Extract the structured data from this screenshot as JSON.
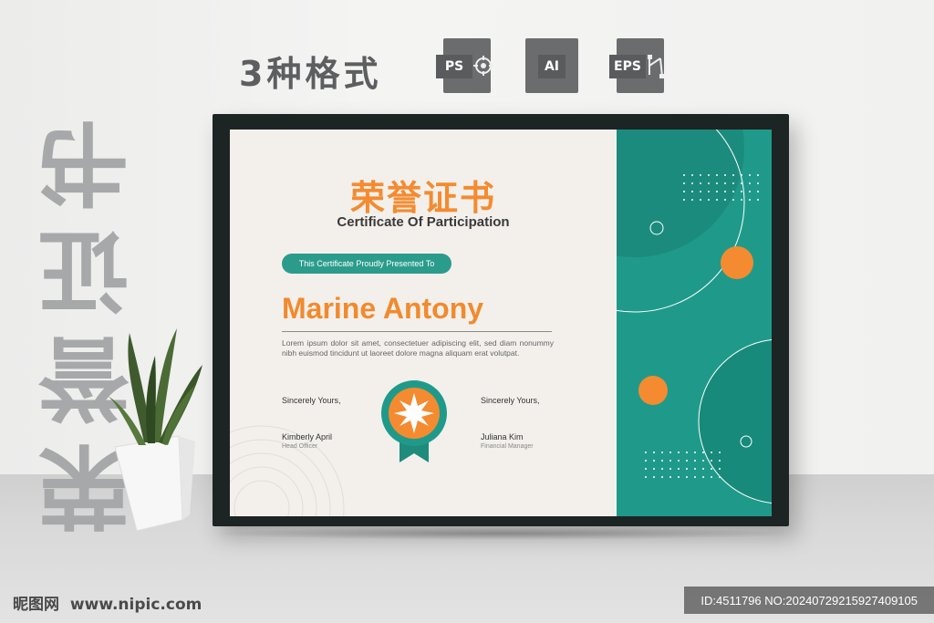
{
  "banner": {
    "formats_title": "3种格式",
    "formats": [
      {
        "label": "PS",
        "icon": "target-icon"
      },
      {
        "label": "AI",
        "icon": "none"
      },
      {
        "label": "EPS",
        "icon": "pen-path-icon"
      }
    ]
  },
  "side_text": [
    "荣",
    "誉",
    "证",
    "书"
  ],
  "certificate": {
    "headline": "荣誉证书",
    "subhead": "Certificate Of Participation",
    "presented": "This Certificate Proudly Presented To",
    "recipient": "Marine Antony",
    "body": "Lorem ipsum dolor sit amet, consectetuer adipiscing elit, sed diam nonummy nibh euismod tincidunt ut laoreet dolore magna aliquam erat volutpat.",
    "left_sign": {
      "closing": "Sincerely Yours,",
      "name": "Kimberly April",
      "role": "Head Officer"
    },
    "right_sign": {
      "closing": "Sincerely Yours,",
      "name": "Juliana Kim",
      "role": "Financial Manager"
    },
    "colors": {
      "accent": "#f48b30",
      "teal": "#1f9a8a",
      "paper": "#f3f0ec"
    }
  },
  "watermark": {
    "site_logo": "昵图网",
    "url": "www.nipic.com",
    "id": "ID:4511796 NO:20240729215927409105"
  }
}
